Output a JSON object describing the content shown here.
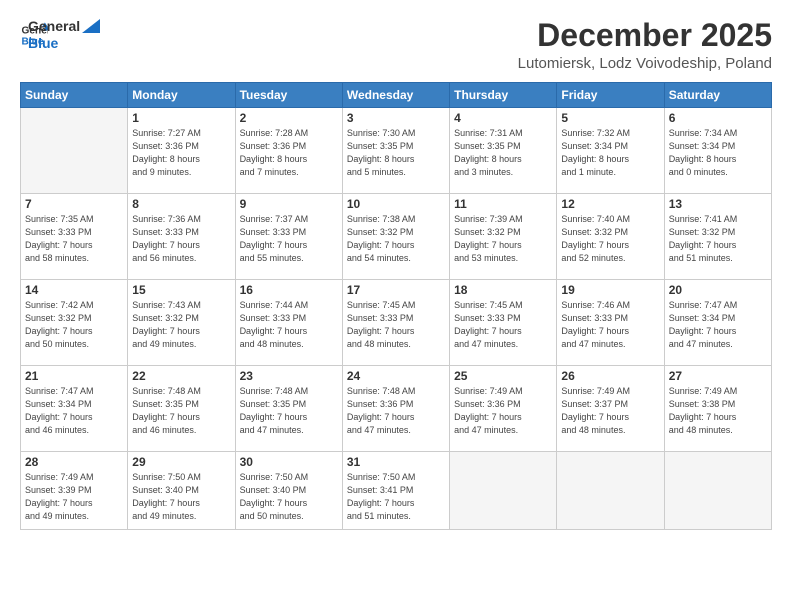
{
  "logo": {
    "line1": "General",
    "line2": "Blue"
  },
  "title": "December 2025",
  "location": "Lutomiersk, Lodz Voivodeship, Poland",
  "days_header": [
    "Sunday",
    "Monday",
    "Tuesday",
    "Wednesday",
    "Thursday",
    "Friday",
    "Saturday"
  ],
  "weeks": [
    [
      {
        "day": "",
        "info": ""
      },
      {
        "day": "1",
        "info": "Sunrise: 7:27 AM\nSunset: 3:36 PM\nDaylight: 8 hours\nand 9 minutes."
      },
      {
        "day": "2",
        "info": "Sunrise: 7:28 AM\nSunset: 3:36 PM\nDaylight: 8 hours\nand 7 minutes."
      },
      {
        "day": "3",
        "info": "Sunrise: 7:30 AM\nSunset: 3:35 PM\nDaylight: 8 hours\nand 5 minutes."
      },
      {
        "day": "4",
        "info": "Sunrise: 7:31 AM\nSunset: 3:35 PM\nDaylight: 8 hours\nand 3 minutes."
      },
      {
        "day": "5",
        "info": "Sunrise: 7:32 AM\nSunset: 3:34 PM\nDaylight: 8 hours\nand 1 minute."
      },
      {
        "day": "6",
        "info": "Sunrise: 7:34 AM\nSunset: 3:34 PM\nDaylight: 8 hours\nand 0 minutes."
      }
    ],
    [
      {
        "day": "7",
        "info": "Sunrise: 7:35 AM\nSunset: 3:33 PM\nDaylight: 7 hours\nand 58 minutes."
      },
      {
        "day": "8",
        "info": "Sunrise: 7:36 AM\nSunset: 3:33 PM\nDaylight: 7 hours\nand 56 minutes."
      },
      {
        "day": "9",
        "info": "Sunrise: 7:37 AM\nSunset: 3:33 PM\nDaylight: 7 hours\nand 55 minutes."
      },
      {
        "day": "10",
        "info": "Sunrise: 7:38 AM\nSunset: 3:32 PM\nDaylight: 7 hours\nand 54 minutes."
      },
      {
        "day": "11",
        "info": "Sunrise: 7:39 AM\nSunset: 3:32 PM\nDaylight: 7 hours\nand 53 minutes."
      },
      {
        "day": "12",
        "info": "Sunrise: 7:40 AM\nSunset: 3:32 PM\nDaylight: 7 hours\nand 52 minutes."
      },
      {
        "day": "13",
        "info": "Sunrise: 7:41 AM\nSunset: 3:32 PM\nDaylight: 7 hours\nand 51 minutes."
      }
    ],
    [
      {
        "day": "14",
        "info": "Sunrise: 7:42 AM\nSunset: 3:32 PM\nDaylight: 7 hours\nand 50 minutes."
      },
      {
        "day": "15",
        "info": "Sunrise: 7:43 AM\nSunset: 3:32 PM\nDaylight: 7 hours\nand 49 minutes."
      },
      {
        "day": "16",
        "info": "Sunrise: 7:44 AM\nSunset: 3:33 PM\nDaylight: 7 hours\nand 48 minutes."
      },
      {
        "day": "17",
        "info": "Sunrise: 7:45 AM\nSunset: 3:33 PM\nDaylight: 7 hours\nand 48 minutes."
      },
      {
        "day": "18",
        "info": "Sunrise: 7:45 AM\nSunset: 3:33 PM\nDaylight: 7 hours\nand 47 minutes."
      },
      {
        "day": "19",
        "info": "Sunrise: 7:46 AM\nSunset: 3:33 PM\nDaylight: 7 hours\nand 47 minutes."
      },
      {
        "day": "20",
        "info": "Sunrise: 7:47 AM\nSunset: 3:34 PM\nDaylight: 7 hours\nand 47 minutes."
      }
    ],
    [
      {
        "day": "21",
        "info": "Sunrise: 7:47 AM\nSunset: 3:34 PM\nDaylight: 7 hours\nand 46 minutes."
      },
      {
        "day": "22",
        "info": "Sunrise: 7:48 AM\nSunset: 3:35 PM\nDaylight: 7 hours\nand 46 minutes."
      },
      {
        "day": "23",
        "info": "Sunrise: 7:48 AM\nSunset: 3:35 PM\nDaylight: 7 hours\nand 47 minutes."
      },
      {
        "day": "24",
        "info": "Sunrise: 7:48 AM\nSunset: 3:36 PM\nDaylight: 7 hours\nand 47 minutes."
      },
      {
        "day": "25",
        "info": "Sunrise: 7:49 AM\nSunset: 3:36 PM\nDaylight: 7 hours\nand 47 minutes."
      },
      {
        "day": "26",
        "info": "Sunrise: 7:49 AM\nSunset: 3:37 PM\nDaylight: 7 hours\nand 48 minutes."
      },
      {
        "day": "27",
        "info": "Sunrise: 7:49 AM\nSunset: 3:38 PM\nDaylight: 7 hours\nand 48 minutes."
      }
    ],
    [
      {
        "day": "28",
        "info": "Sunrise: 7:49 AM\nSunset: 3:39 PM\nDaylight: 7 hours\nand 49 minutes."
      },
      {
        "day": "29",
        "info": "Sunrise: 7:50 AM\nSunset: 3:40 PM\nDaylight: 7 hours\nand 49 minutes."
      },
      {
        "day": "30",
        "info": "Sunrise: 7:50 AM\nSunset: 3:40 PM\nDaylight: 7 hours\nand 50 minutes."
      },
      {
        "day": "31",
        "info": "Sunrise: 7:50 AM\nSunset: 3:41 PM\nDaylight: 7 hours\nand 51 minutes."
      },
      {
        "day": "",
        "info": ""
      },
      {
        "day": "",
        "info": ""
      },
      {
        "day": "",
        "info": ""
      }
    ]
  ]
}
